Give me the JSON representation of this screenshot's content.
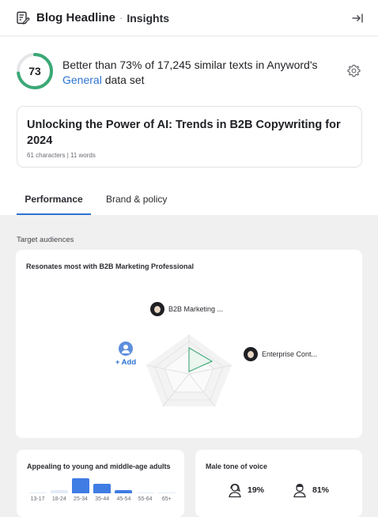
{
  "header": {
    "title": "Blog Headline",
    "separator": "·",
    "subtitle": "Insights",
    "icons": {
      "document": "edit-document-icon",
      "collapse": "collapse-panel-icon"
    }
  },
  "score": {
    "value": "73",
    "fraction": 0.73,
    "text_line": "Better than 73% of 17,245 similar texts in Anyword's",
    "dataset_link": "General",
    "dataset_suffix": "data set",
    "ring_color": "#3ba876"
  },
  "headline": {
    "text": "Unlocking the Power of AI: Trends in B2B Copywriting for 2024",
    "meta": "61 characters | 11 words"
  },
  "tabs": [
    {
      "label": "Performance",
      "active": true
    },
    {
      "label": "Brand & policy",
      "active": false
    }
  ],
  "audiences": {
    "section_label": "Target audiences",
    "card_title": "Resonates most with B2B Marketing Professional",
    "top_node": "B2B Marketing ...",
    "right_node": "Enterprise Cont...",
    "add_label": "+ Add",
    "shape_color": "#3ba876"
  },
  "age": {
    "title": "Appealing to young and middle-age adults",
    "groups": [
      "13-17",
      "18-24",
      "25-34",
      "35-44",
      "45-54",
      "55-64",
      "65+"
    ],
    "levels": [
      0.04,
      0.18,
      0.85,
      0.55,
      0.18,
      0.04,
      0.04
    ],
    "highlight": [
      false,
      false,
      true,
      true,
      true,
      false,
      false
    ],
    "bar_color": "#3f7ce4"
  },
  "tone": {
    "title": "Male tone of voice",
    "female_pct": "19%",
    "male_pct": "81%"
  }
}
